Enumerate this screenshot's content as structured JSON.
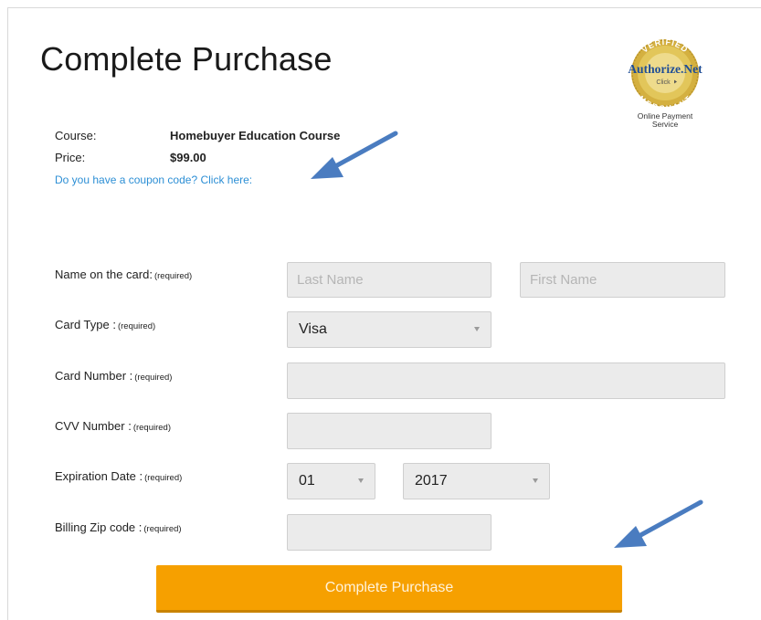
{
  "header": {
    "title": "Complete Purchase"
  },
  "seal": {
    "top_text": "VERIFIED",
    "brand": "Authorize.Net",
    "click_text": "Click",
    "bottom_text": "MERCHANT",
    "caption_line1": "Online Payment",
    "caption_line2": "Service"
  },
  "summary": {
    "course_label": "Course:",
    "course_value": "Homebuyer Education Course",
    "price_label": "Price:",
    "price_value": "$99.00",
    "coupon_link": "Do you have a coupon code? Click here:"
  },
  "form": {
    "required_text": "(required)",
    "name_label": "Name on the card:",
    "last_name_placeholder": "Last Name",
    "first_name_placeholder": "First Name",
    "card_type_label": "Card Type :",
    "card_type_value": "Visa",
    "card_number_label": "Card Number :",
    "cvv_label": "CVV Number :",
    "expiration_label": "Expiration Date :",
    "exp_month_value": "01",
    "exp_year_value": "2017",
    "zip_label": "Billing Zip code :",
    "submit_label": "Complete Purchase"
  },
  "colors": {
    "link": "#2d8fd5",
    "button": "#f6a000",
    "annotation_arrow": "#4a7cc0",
    "field_bg": "#ebebeb",
    "seal_gold": "#c9a227"
  },
  "icons": {
    "annotation": "arrow-icon",
    "dropdown": "chevron-down-icon",
    "seal": "authorize-net-seal-icon"
  }
}
